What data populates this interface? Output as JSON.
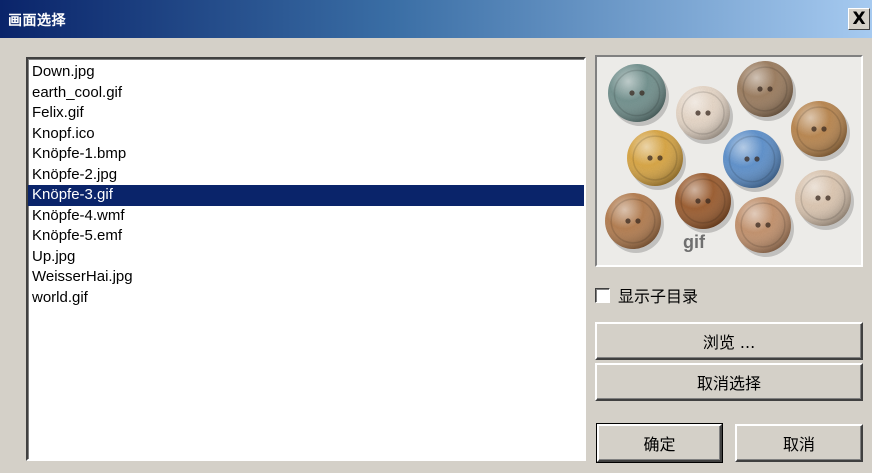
{
  "window": {
    "title": "画面选择",
    "close_glyph": "X"
  },
  "file_list": {
    "items": [
      "Down.jpg",
      "earth_cool.gif",
      "Felix.gif",
      "Knopf.ico",
      "Knöpfe-1.bmp",
      "Knöpfe-2.jpg",
      "Knöpfe-3.gif",
      "Knöpfe-4.wmf",
      "Knöpfe-5.emf",
      "Up.jpg",
      "WeisserHai.jpg",
      "world.gif"
    ],
    "selected": "Knöpfe-3.gif"
  },
  "preview": {
    "watermark": "gif",
    "image_icon": "buttons-image-icon"
  },
  "options": {
    "show_subdirs_label": "显示子目录",
    "show_subdirs_checked": false
  },
  "buttons": {
    "browse": "浏览 ...",
    "deselect": "取消选择",
    "ok": "确定",
    "cancel": "取消"
  },
  "colors": {
    "selection": "#0a246a",
    "titlebar_start": "#0a246a",
    "dialog_bg": "#d4d0c8"
  }
}
